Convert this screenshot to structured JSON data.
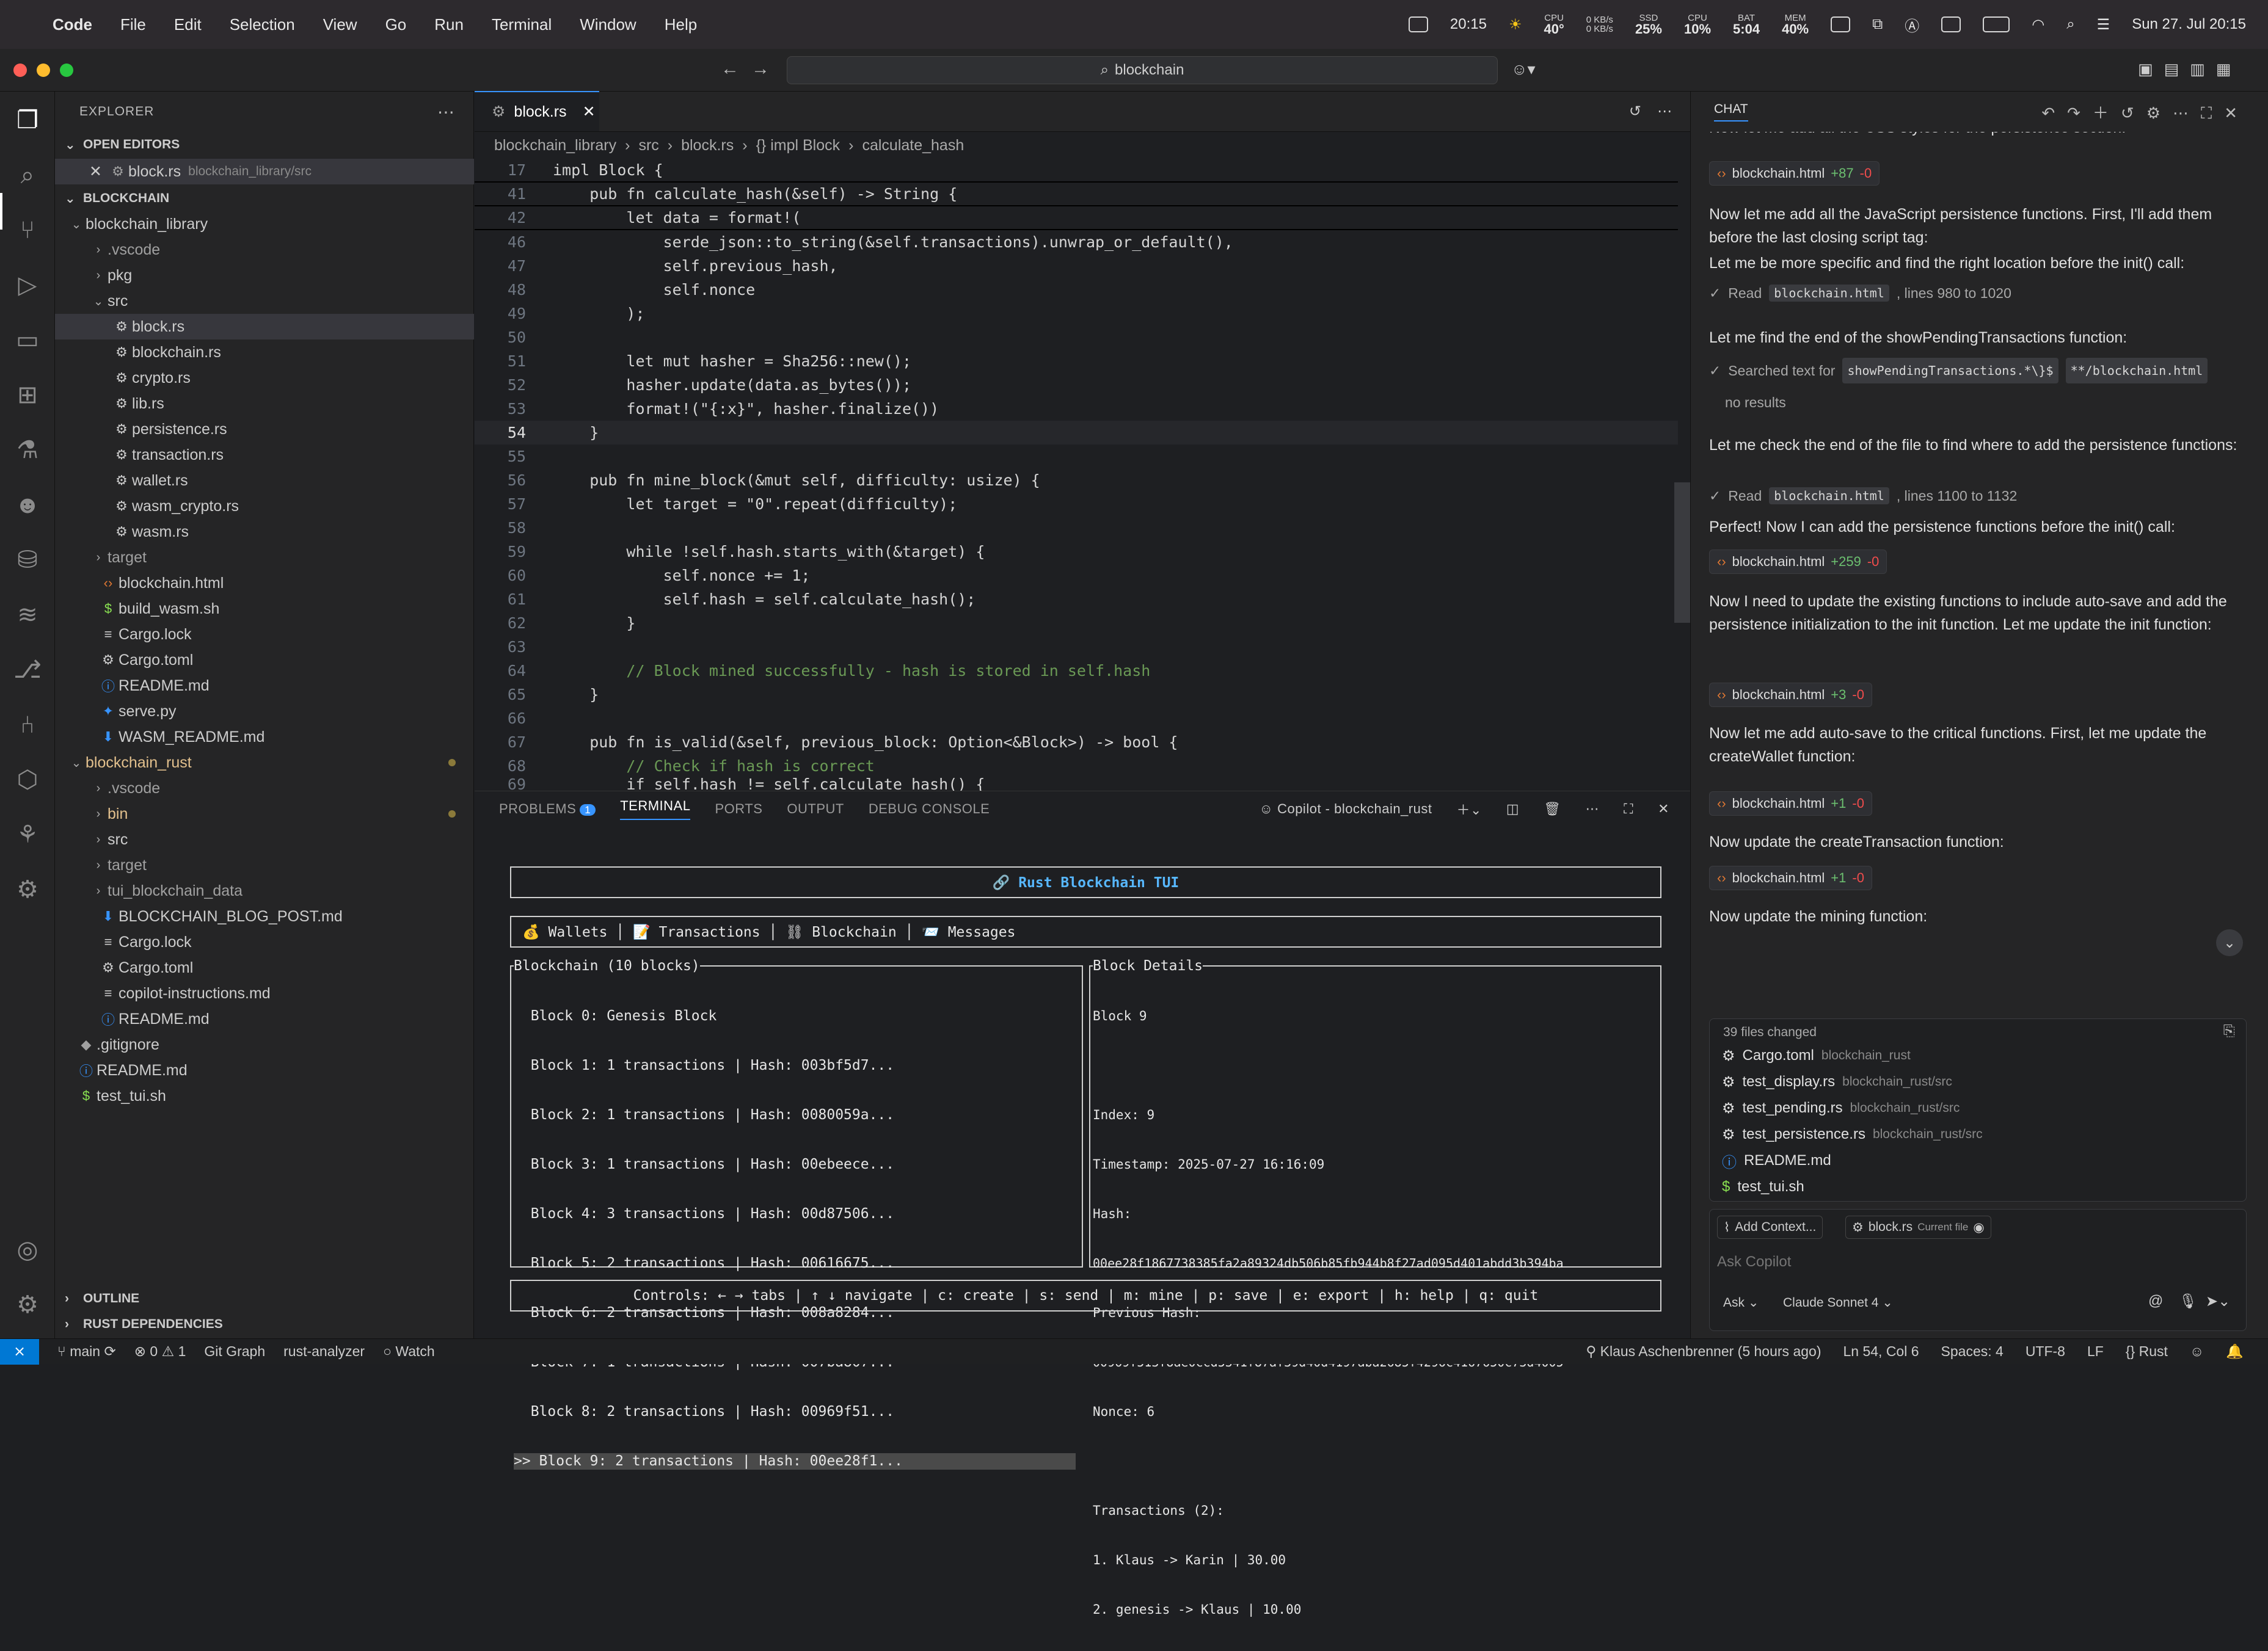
{
  "menubar": {
    "app": "Code",
    "items": [
      "File",
      "Edit",
      "Selection",
      "View",
      "Go",
      "Run",
      "Terminal",
      "Window",
      "Help"
    ],
    "time": "20:15",
    "stats": [
      {
        "k": "CPU",
        "v": "40°"
      },
      {
        "k": "0 KB/s",
        "v": "0 KB/s"
      },
      {
        "k": "SSD",
        "v": "25%"
      },
      {
        "k": "CPU",
        "v": "10%"
      },
      {
        "k": "BAT",
        "v": "5:04"
      },
      {
        "k": "MEM",
        "v": "40%"
      }
    ],
    "date": "Sun 27. Jul 20:15"
  },
  "titlebar": {
    "search": "blockchain"
  },
  "sidebar": {
    "title": "EXPLORER",
    "open_editors": "OPEN EDITORS",
    "open_file": "block.rs",
    "open_file_path": "blockchain_library/src",
    "root": "BLOCKCHAIN",
    "items": [
      "blockchain_library",
      ".vscode",
      "pkg",
      "src",
      "block.rs",
      "blockchain.rs",
      "crypto.rs",
      "lib.rs",
      "persistence.rs",
      "transaction.rs",
      "wallet.rs",
      "wasm_crypto.rs",
      "wasm.rs",
      "target",
      "blockchain.html",
      "build_wasm.sh",
      "Cargo.lock",
      "Cargo.toml",
      "README.md",
      "serve.py",
      "WASM_README.md",
      "blockchain_rust",
      ".vscode",
      "bin",
      "src",
      "target",
      "tui_blockchain_data",
      "BLOCKCHAIN_BLOG_POST.md",
      "Cargo.lock",
      "Cargo.toml",
      "copilot-instructions.md",
      "README.md",
      ".gitignore",
      "README.md",
      "test_tui.sh"
    ],
    "outline": "OUTLINE",
    "rust_deps": "RUST DEPENDENCIES"
  },
  "editor": {
    "tab": "block.rs",
    "breadcrumb": [
      "blockchain_library",
      "src",
      "block.rs",
      "{} impl Block",
      "calculate_hash"
    ],
    "line_numbers": [
      "17",
      "41",
      "42",
      "46",
      "47",
      "48",
      "49",
      "50",
      "51",
      "52",
      "53",
      "54",
      "55",
      "56",
      "57",
      "58",
      "59",
      "60",
      "61",
      "62",
      "63",
      "64",
      "65",
      "66",
      "67",
      "68",
      "69"
    ],
    "lines": [
      "impl Block {",
      "    pub fn calculate_hash(&self) -> String {",
      "        let data = format!(",
      "            serde_json::to_string(&self.transactions).unwrap_or_default(),",
      "            self.previous_hash,",
      "            self.nonce",
      "        );",
      "",
      "        let mut hasher = Sha256::new();",
      "        hasher.update(data.as_bytes());",
      "        format!(\"{:x}\", hasher.finalize())",
      "    }",
      "",
      "    pub fn mine_block(&mut self, difficulty: usize) {",
      "        let target = \"0\".repeat(difficulty);",
      "",
      "        while !self.hash.starts_with(&target) {",
      "            self.nonce += 1;",
      "            self.hash = self.calculate_hash();",
      "        }",
      "",
      "        // Block mined successfully - hash is stored in self.hash",
      "    }",
      "",
      "    pub fn is_valid(&self, previous_block: Option<&Block>) -> bool {",
      "        // Check if hash is correct",
      "        if self.hash != self.calculate_hash() {"
    ]
  },
  "panel": {
    "tabs": [
      "PROBLEMS",
      "TERMINAL",
      "PORTS",
      "OUTPUT",
      "DEBUG CONSOLE"
    ],
    "problems_count": "1",
    "terminal_name": "Copilot - blockchain_rust",
    "tui_title": "🔗 Rust Blockchain TUI",
    "tui_tabs": "💰 Wallets │ 📝 Transactions │ ⛓ Blockchain │ 📨 Messages",
    "chain_title": "Blockchain (10 blocks)",
    "blocks": [
      "  Block 0: Genesis Block",
      "  Block 1: 1 transactions | Hash: 003bf5d7...",
      "  Block 2: 1 transactions | Hash: 0080059a...",
      "  Block 3: 1 transactions | Hash: 00ebeece...",
      "  Block 4: 3 transactions | Hash: 00d87506...",
      "  Block 5: 2 transactions | Hash: 00616675...",
      "  Block 6: 2 transactions | Hash: 008a8284...",
      "  Block 7: 1 transactions | Hash: 007ba807...",
      "  Block 8: 2 transactions | Hash: 00969f51...",
      ">> Block 9: 2 transactions | Hash: 00ee28f1..."
    ],
    "details_title": "Block Details",
    "details": [
      "Block 9",
      "",
      "Index: 9",
      "Timestamp: 2025-07-27 16:16:09",
      "Hash:",
      "00ee28f1867738385fa2a89324db506b85fb944b8f27ad095d401abdd3b394ba",
      "Previous Hash:",
      "00969f513f8ae0ccd5341f87af39d40d4197aba2685f4296c4167650c73d4005",
      "Nonce: 6",
      "",
      "Transactions (2):",
      "1. Klaus -> Karin | 30.00",
      "2. genesis -> Klaus | 10.00"
    ],
    "controls": "Controls: ← → tabs | ↑ ↓ navigate | c: create | s: send | m: mine | p: save | e: export | h: help | q: quit"
  },
  "chat": {
    "title": "CHAT",
    "top_partial": "Now let me add all the CSS styles for the persistence section:",
    "blocks": [
      {
        "type": "pill",
        "file": "blockchain.html",
        "plus": "+87",
        "minus": "-0"
      },
      {
        "type": "text",
        "text": "Now let me add all the JavaScript persistence functions. First, I'll add them before the last closing script tag:"
      },
      {
        "type": "text",
        "text": "Let me be more specific and find the right location before the init() call:"
      },
      {
        "type": "read",
        "label": "Read",
        "file": "blockchain.html",
        "detail": ", lines 980 to 1020"
      },
      {
        "type": "text",
        "text": "Let me find the end of the showPendingTransactions function:"
      },
      {
        "type": "search",
        "label": "Searched text for",
        "query": "showPendingTransactions.*\\}$",
        "glob": "**/blockchain.html",
        "result": "no results"
      },
      {
        "type": "text",
        "text": "Let me check the end of the file to find where to add the persistence functions:"
      },
      {
        "type": "read",
        "label": "Read",
        "file": "blockchain.html",
        "detail": ", lines 1100 to 1132"
      },
      {
        "type": "text",
        "text": "Perfect! Now I can add the persistence functions before the init() call:"
      },
      {
        "type": "pill",
        "file": "blockchain.html",
        "plus": "+259",
        "minus": "-0"
      },
      {
        "type": "text",
        "text": "Now I need to update the existing functions to include auto-save and add the persistence initialization to the init function. Let me update the init function:"
      },
      {
        "type": "pill",
        "file": "blockchain.html",
        "plus": "+3",
        "minus": "-0"
      },
      {
        "type": "text",
        "text": "Now let me add auto-save to the critical functions. First, let me update the createWallet function:"
      },
      {
        "type": "pill",
        "file": "blockchain.html",
        "plus": "+1",
        "minus": "-0"
      },
      {
        "type": "text",
        "text": "Now update the createTransaction function:"
      },
      {
        "type": "pill",
        "file": "blockchain.html",
        "plus": "+1",
        "minus": "-0"
      },
      {
        "type": "text",
        "text": "Now update the mining function:"
      }
    ],
    "changes_title": "39 files changed",
    "changes": [
      {
        "icon": "gear-icon",
        "name": "Cargo.toml",
        "path": "blockchain_rust"
      },
      {
        "icon": "rust-icon",
        "name": "test_display.rs",
        "path": "blockchain_rust/src"
      },
      {
        "icon": "rust-icon",
        "name": "test_pending.rs",
        "path": "blockchain_rust/src"
      },
      {
        "icon": "rust-icon",
        "name": "test_persistence.rs",
        "path": "blockchain_rust/src"
      },
      {
        "icon": "info-icon",
        "name": "README.md",
        "path": ""
      },
      {
        "icon": "shell-icon",
        "name": "test_tui.sh",
        "path": ""
      }
    ],
    "add_context": "Add Context...",
    "context_file": "block.rs",
    "context_file_note": "Current file",
    "input_placeholder": "Ask Copilot",
    "mode": "Ask",
    "model": "Claude Sonnet 4"
  },
  "statusbar": {
    "branch": "main",
    "errors": "0",
    "warnings": "1",
    "git_graph": "Git Graph",
    "analyzer": "rust-analyzer",
    "watch": "Watch",
    "blame": "Klaus Aschenbrenner (5 hours ago)",
    "position": "Ln 54, Col 6",
    "spaces": "Spaces: 4",
    "encoding": "UTF-8",
    "eol": "LF",
    "language": "{} Rust"
  },
  "colors": {
    "accent": "#3794ff",
    "bg": "#1e1f22",
    "sidebar": "#252526"
  }
}
